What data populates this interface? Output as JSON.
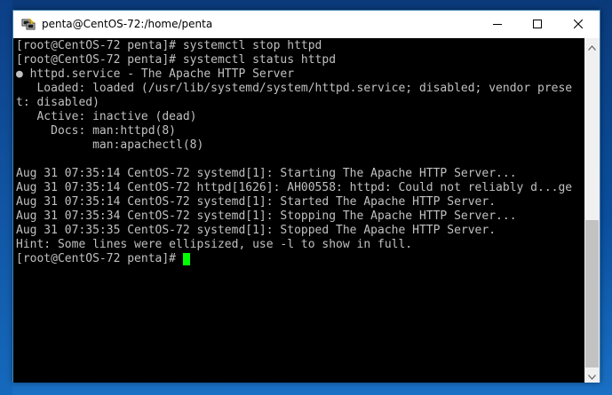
{
  "window": {
    "title": "penta@CentOS-72:/home/penta",
    "controls": {
      "minimize": "minimize-icon",
      "maximize": "maximize-icon",
      "close": "close-icon"
    }
  },
  "terminal": {
    "background": "#000000",
    "text_color": "#c0c0c0",
    "cursor_color": "#00ff00",
    "lines": [
      "[root@CentOS-72 penta]# systemctl stop httpd",
      "[root@CentOS-72 penta]# systemctl status httpd",
      "● httpd.service - The Apache HTTP Server",
      "   Loaded: loaded (/usr/lib/systemd/system/httpd.service; disabled; vendor prese",
      "t: disabled)",
      "   Active: inactive (dead)",
      "     Docs: man:httpd(8)",
      "           man:apachectl(8)",
      "",
      "Aug 31 07:35:14 CentOS-72 systemd[1]: Starting The Apache HTTP Server...",
      "Aug 31 07:35:14 CentOS-72 httpd[1626]: AH00558: httpd: Could not reliably d...ge",
      "Aug 31 07:35:14 CentOS-72 systemd[1]: Started The Apache HTTP Server.",
      "Aug 31 07:35:34 CentOS-72 systemd[1]: Stopping The Apache HTTP Server...",
      "Aug 31 07:35:35 CentOS-72 systemd[1]: Stopped The Apache HTTP Server.",
      "Hint: Some lines were ellipsized, use -l to show in full.",
      "[root@CentOS-72 penta]# "
    ],
    "scrollbar": {
      "thumb_position": 0.53,
      "thumb_fraction": 0.47
    }
  }
}
